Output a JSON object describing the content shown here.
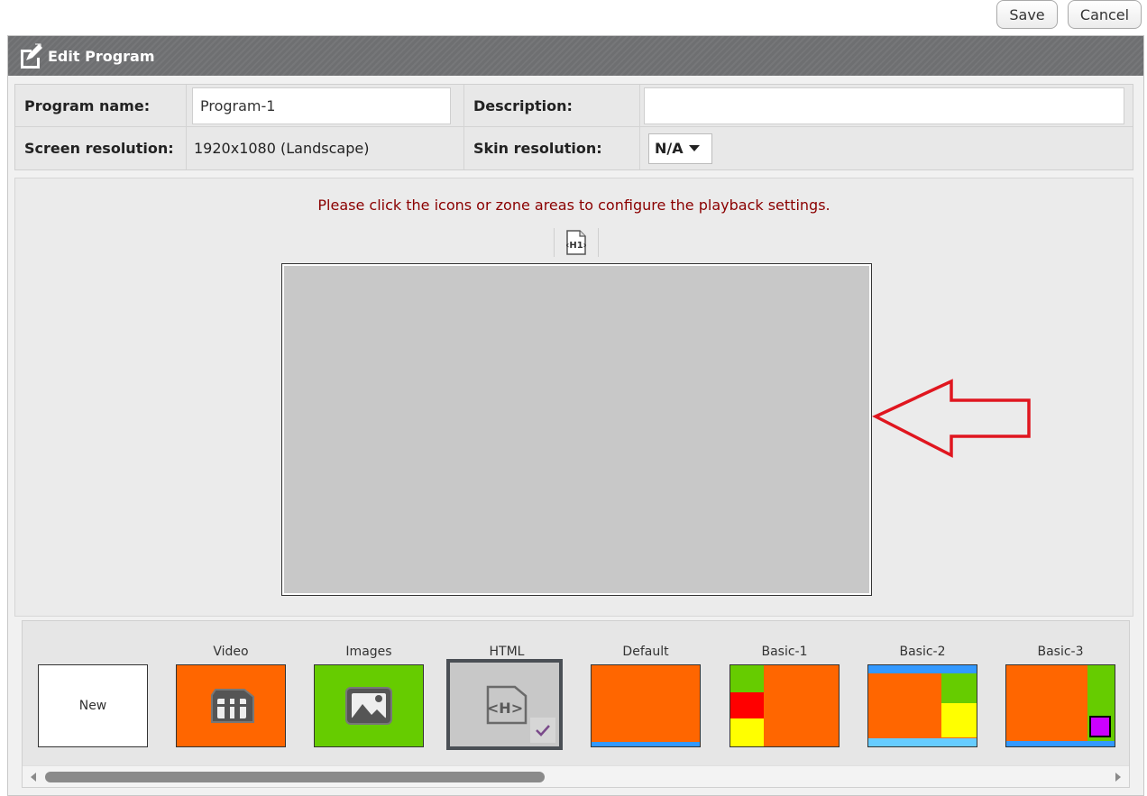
{
  "toolbar": {
    "save_label": "Save",
    "cancel_label": "Cancel"
  },
  "panel": {
    "title": "Edit Program",
    "icon": "edit-icon"
  },
  "form": {
    "program_name_label": "Program name:",
    "program_name_value": "Program-1",
    "description_label": "Description:",
    "description_value": "",
    "screen_resolution_label": "Screen resolution:",
    "screen_resolution_value": "1920x1080 (Landscape)",
    "skin_resolution_label": "Skin resolution:",
    "skin_resolution_value": "N/A"
  },
  "editor": {
    "hint": "Please click the icons or zone areas to configure the playback settings.",
    "zone_icon": "html-zone-icon",
    "annotation": "red-arrow-pointing-left"
  },
  "templates": [
    {
      "label": "",
      "thumb_text": "New",
      "style": "white"
    },
    {
      "label": "Video",
      "icon": "video-icon",
      "color": "#ff6600"
    },
    {
      "label": "Images",
      "icon": "image-icon",
      "color": "#66cc00"
    },
    {
      "label": "HTML",
      "icon": "html-icon",
      "color": "#c8c8c8",
      "selected": true
    },
    {
      "label": "Default",
      "color": "#ff6600"
    },
    {
      "label": "Basic-1",
      "colors": [
        "#66cc00",
        "#ff0000",
        "#ffff00",
        "#ff6600"
      ]
    },
    {
      "label": "Basic-2",
      "colors": [
        "#3399ff",
        "#ff6600",
        "#66cc00",
        "#ffff00",
        "#66ccff"
      ]
    },
    {
      "label": "Basic-3",
      "colors": [
        "#ff6600",
        "#66cc00",
        "#cc00ff",
        "#3399ff"
      ]
    }
  ],
  "colors": {
    "header_bg": "#6e6f71",
    "hint_text": "#8b0000",
    "arrow": "#e0161f"
  }
}
